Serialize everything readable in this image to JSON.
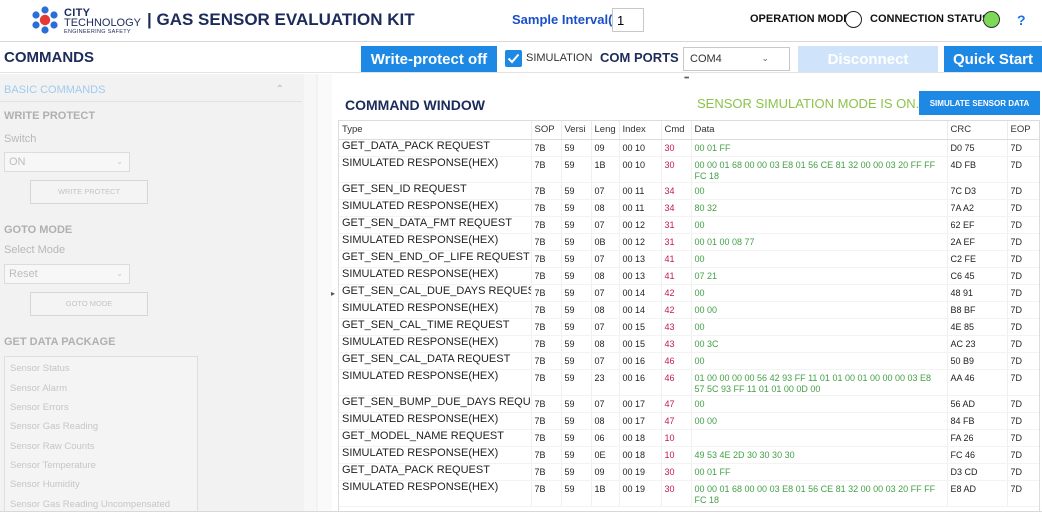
{
  "header": {
    "logo": {
      "line1": "CITY",
      "line2": "TECHNOLOGY",
      "line3": "ENGINEERING SAFETY"
    },
    "app_title": "| GAS SENSOR EVALUATION KIT",
    "sample_interval_label": "Sample Interval(S)",
    "sample_interval_value": "1",
    "operation_mode_label": "OPERATION MODE",
    "connection_status_label": "CONNECTION STATUS",
    "connection_color": "#7ed957",
    "help": "?"
  },
  "toolbar": {
    "commands_title": "COMMANDS",
    "write_protect_label": "Write-protect off",
    "simulation_label": "SIMULATION",
    "simulation_checked": true,
    "com_ports_label": "COM PORTS",
    "com_port_value": "COM4",
    "disconnect_label": "Disconnect",
    "quick_start_label": "Quick Start",
    "accent_color": "#1e88e5"
  },
  "sidebar": {
    "header": "BASIC COMMANDS",
    "write_protect": {
      "section": "WRITE PROTECT",
      "switch_label": "Switch",
      "switch_value": "ON",
      "button_label": "WRITE PROTECT"
    },
    "goto_mode": {
      "section": "GOTO MODE",
      "select_label": "Select Mode",
      "select_value": "Reset",
      "button_label": "GOTO MODE"
    },
    "get_data_package": {
      "section": "GET DATA PACKAGE",
      "items": [
        "Sensor Status",
        "Sensor Alarm",
        "Sensor Errors",
        "Sensor Gas Reading",
        "Sensor Raw Counts",
        "Sensor Temperature",
        "Sensor Humidity",
        "Sensor Gas Reading Uncompensated"
      ]
    }
  },
  "command_window": {
    "title": "COMMAND WINDOW",
    "status": "SENSOR SIMULATION MODE IS ON..",
    "simulate_button": "SIMULATE SENSOR DATA",
    "columns": [
      "Type",
      "SOP",
      "Versi",
      "Leng",
      "Index",
      "Cmd",
      "Data",
      "CRC",
      "EOP"
    ],
    "rows": [
      {
        "type": "GET_DATA_PACK REQUEST",
        "sop": "7B",
        "ver": "59",
        "len": "09",
        "index": "00 10",
        "cmd": "30",
        "data": "00 01 FF",
        "crc": "D0 75",
        "eop": "7D"
      },
      {
        "type": "SIMULATED RESPONSE(HEX)",
        "sop": "7B",
        "ver": "59",
        "len": "1B",
        "index": "00 10",
        "cmd": "30",
        "data": "00 00 01 68 00 00 03 E8 01 56 CE 81 32 00 00 03 20 FF FF FC 18",
        "crc": "4D FB",
        "eop": "7D"
      },
      {
        "type": "GET_SEN_ID REQUEST",
        "sop": "7B",
        "ver": "59",
        "len": "07",
        "index": "00 11",
        "cmd": "34",
        "data": "00",
        "crc": "7C D3",
        "eop": "7D"
      },
      {
        "type": "SIMULATED RESPONSE(HEX)",
        "sop": "7B",
        "ver": "59",
        "len": "08",
        "index": "00 11",
        "cmd": "34",
        "data": "80 32",
        "crc": "7A A2",
        "eop": "7D"
      },
      {
        "type": "GET_SEN_DATA_FMT REQUEST",
        "sop": "7B",
        "ver": "59",
        "len": "07",
        "index": "00 12",
        "cmd": "31",
        "data": "00",
        "crc": "62 EF",
        "eop": "7D"
      },
      {
        "type": "SIMULATED RESPONSE(HEX)",
        "sop": "7B",
        "ver": "59",
        "len": "0B",
        "index": "00 12",
        "cmd": "31",
        "data": "00 01 00 08 77",
        "crc": "2A EF",
        "eop": "7D"
      },
      {
        "type": "GET_SEN_END_OF_LIFE REQUEST",
        "sop": "7B",
        "ver": "59",
        "len": "07",
        "index": "00 13",
        "cmd": "41",
        "data": "00",
        "crc": "C2 FE",
        "eop": "7D"
      },
      {
        "type": "SIMULATED RESPONSE(HEX)",
        "sop": "7B",
        "ver": "59",
        "len": "08",
        "index": "00 13",
        "cmd": "41",
        "data": "07 21",
        "crc": "C6 45",
        "eop": "7D"
      },
      {
        "type": "GET_SEN_CAL_DUE_DAYS REQUEST",
        "sop": "7B",
        "ver": "59",
        "len": "07",
        "index": "00 14",
        "cmd": "42",
        "data": "00",
        "crc": "48 91",
        "eop": "7D"
      },
      {
        "type": "SIMULATED RESPONSE(HEX)",
        "sop": "7B",
        "ver": "59",
        "len": "08",
        "index": "00 14",
        "cmd": "42",
        "data": "00 00",
        "crc": "B8 BF",
        "eop": "7D"
      },
      {
        "type": "GET_SEN_CAL_TIME REQUEST",
        "sop": "7B",
        "ver": "59",
        "len": "07",
        "index": "00 15",
        "cmd": "43",
        "data": "00",
        "crc": "4E 85",
        "eop": "7D"
      },
      {
        "type": "SIMULATED RESPONSE(HEX)",
        "sop": "7B",
        "ver": "59",
        "len": "08",
        "index": "00 15",
        "cmd": "43",
        "data": "00 3C",
        "crc": "AC 23",
        "eop": "7D"
      },
      {
        "type": "GET_SEN_CAL_DATA REQUEST",
        "sop": "7B",
        "ver": "59",
        "len": "07",
        "index": "00 16",
        "cmd": "46",
        "data": "00",
        "crc": "50 B9",
        "eop": "7D"
      },
      {
        "type": "SIMULATED RESPONSE(HEX)",
        "sop": "7B",
        "ver": "59",
        "len": "23",
        "index": "00 16",
        "cmd": "46",
        "data": "01 00 00 00 00 56 42 93 FF 11 01 01 00 01 00 00 00 03 E8 57 5C 93 FF 11 01 01 00 0D 00",
        "crc": "AA 46",
        "eop": "7D"
      },
      {
        "type": "GET_SEN_BUMP_DUE_DAYS REQUEST",
        "sop": "7B",
        "ver": "59",
        "len": "07",
        "index": "00 17",
        "cmd": "47",
        "data": "00",
        "crc": "56 AD",
        "eop": "7D"
      },
      {
        "type": "SIMULATED RESPONSE(HEX)",
        "sop": "7B",
        "ver": "59",
        "len": "08",
        "index": "00 17",
        "cmd": "47",
        "data": "00 00",
        "crc": "84 FB",
        "eop": "7D"
      },
      {
        "type": "GET_MODEL_NAME REQUEST",
        "sop": "7B",
        "ver": "59",
        "len": "06",
        "index": "00 18",
        "cmd": "10",
        "data": "",
        "crc": "FA 26",
        "eop": "7D"
      },
      {
        "type": "SIMULATED RESPONSE(HEX)",
        "sop": "7B",
        "ver": "59",
        "len": "0E",
        "index": "00 18",
        "cmd": "10",
        "data": "49 53 4E 2D 30 30 30 30",
        "crc": "FC 46",
        "eop": "7D"
      },
      {
        "type": "GET_DATA_PACK REQUEST",
        "sop": "7B",
        "ver": "59",
        "len": "09",
        "index": "00 19",
        "cmd": "30",
        "data": "00 01 FF",
        "crc": "D3 CD",
        "eop": "7D"
      },
      {
        "type": "SIMULATED RESPONSE(HEX)",
        "sop": "7B",
        "ver": "59",
        "len": "1B",
        "index": "00 19",
        "cmd": "30",
        "data": "00 00 01 68 00 00 03 E8 01 56 CE 81 32 00 00 03 20 FF FF FC 18",
        "crc": "E8 AD",
        "eop": "7D"
      }
    ]
  }
}
